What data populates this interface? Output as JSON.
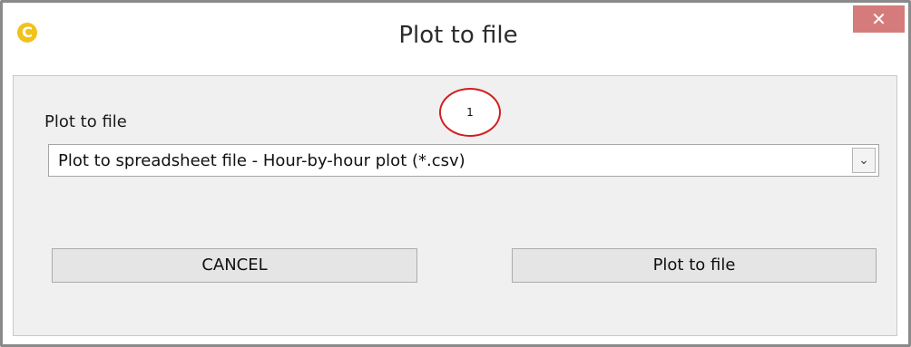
{
  "window": {
    "title": "Plot to file",
    "close_glyph": "✕",
    "app_icon_glyph": "C",
    "app_icon": "app-logo-icon"
  },
  "form": {
    "field_label": "Plot to file",
    "select_value": "Plot to spreadsheet file - Hour-by-hour plot (*.csv)",
    "select_arrow_glyph": "⌄"
  },
  "buttons": {
    "cancel_label": "CANCEL",
    "plot_label": "Plot to file"
  },
  "annotation": {
    "callout_number": "1",
    "callout_color": "#d21f1f"
  },
  "colors": {
    "close_button": "#c75050",
    "app_icon": "#f2c21c",
    "client_background": "#f0f0f0"
  }
}
